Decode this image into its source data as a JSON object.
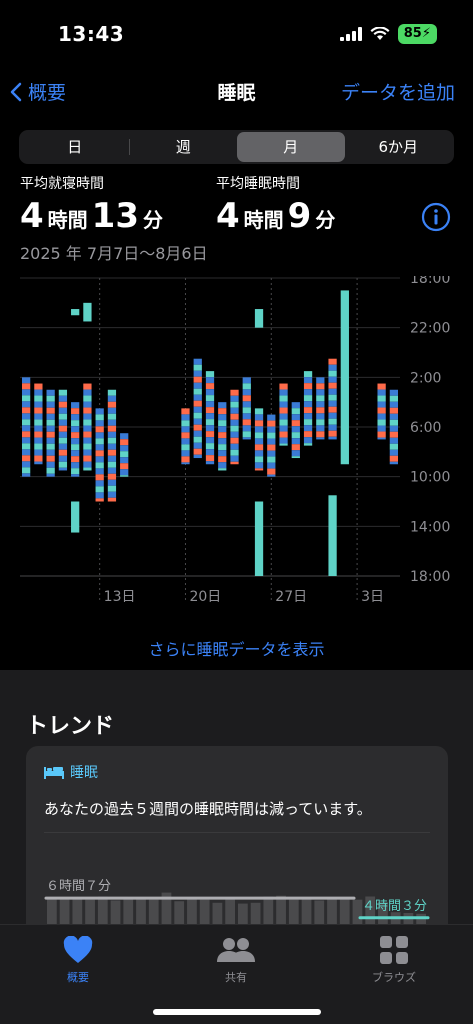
{
  "status": {
    "time": "13:43",
    "battery": "85"
  },
  "nav": {
    "back_label": "概要",
    "title": "睡眠",
    "add_label": "データを追加"
  },
  "segments": [
    "日",
    "週",
    "月",
    "6か月"
  ],
  "active_segment": "月",
  "stats": {
    "bedtime_label": "平均就寝時間",
    "bedtime_hours": "4",
    "bedtime_minutes": "13",
    "sleep_label": "平均睡眠時間",
    "sleep_hours": "4",
    "sleep_minutes": "9",
    "hour_unit": "時間",
    "minute_unit": "分"
  },
  "date_range": "2025 年 7月7日～8月6日",
  "chart_data": {
    "type": "bar",
    "y_tick_labels": [
      "18:00",
      "22:00",
      "2:00",
      "6:00",
      "10:00",
      "14:00",
      "18:00"
    ],
    "x_tick_labels": [
      "13日",
      "20日",
      "27日",
      "3日"
    ],
    "series_colors": {
      "core": "#3a7bd5",
      "deep": "#ff6b4a",
      "rem": "#5fd3c7",
      "awake": "#f06a50"
    },
    "nights": [
      {
        "x": 0,
        "start": 2.0,
        "end": 10.0
      },
      {
        "x": 1,
        "start": 2.5,
        "end": 9.0
      },
      {
        "x": 2,
        "start": 3.0,
        "end": 10.0
      },
      {
        "x": 3,
        "start": 3.0,
        "end": 9.5
      },
      {
        "x": 4,
        "start": 4.0,
        "end": 10.0
      },
      {
        "x": 5,
        "start": 2.5,
        "end": 9.5
      },
      {
        "x": 6,
        "start": 4.5,
        "end": 12.0
      },
      {
        "x": 7,
        "start": 3.0,
        "end": 12.0
      },
      {
        "x": 8,
        "start": 6.5,
        "end": 10.0
      },
      {
        "x": 13,
        "start": 4.5,
        "end": 9.0
      },
      {
        "x": 14,
        "start": 0.5,
        "end": 8.5
      },
      {
        "x": 15,
        "start": 1.5,
        "end": 9.0
      },
      {
        "x": 16,
        "start": 4.0,
        "end": 9.5
      },
      {
        "x": 17,
        "start": 3.0,
        "end": 9.0
      },
      {
        "x": 18,
        "start": 2.0,
        "end": 7.0
      },
      {
        "x": 19,
        "start": 4.5,
        "end": 9.5
      },
      {
        "x": 20,
        "start": 5.0,
        "end": 10.0
      },
      {
        "x": 21,
        "start": 2.5,
        "end": 7.5
      },
      {
        "x": 22,
        "start": 4.0,
        "end": 8.5
      },
      {
        "x": 23,
        "start": 1.5,
        "end": 7.5
      },
      {
        "x": 24,
        "start": 2.0,
        "end": 7.0
      },
      {
        "x": 25,
        "start": 0.5,
        "end": 7.0
      },
      {
        "x": 29,
        "start": 2.5,
        "end": 7.0
      },
      {
        "x": 30,
        "start": 3.0,
        "end": 9.0
      }
    ],
    "naps": [
      {
        "x": 4,
        "start": 12.0,
        "end": 14.5
      },
      {
        "x": 4,
        "start": 20.5,
        "end": 21.0
      },
      {
        "x": 5,
        "start": 20.0,
        "end": 21.5
      },
      {
        "x": 19,
        "start": 12.0,
        "end": 18.0
      },
      {
        "x": 19,
        "start": 20.5,
        "end": 22.0
      },
      {
        "x": 25,
        "start": 11.5,
        "end": 18.0
      },
      {
        "x": 26,
        "start": 19.0,
        "end": 9.0
      }
    ]
  },
  "more_link": "さらに睡眠データを表示",
  "trend": {
    "title": "トレンド",
    "card_title": "睡眠",
    "card_text": "あなたの過去５週間の睡眠時間は減っています。",
    "baseline_label": "６時間７分",
    "current_label": "４時間３分",
    "bars": [
      6.2,
      6.1,
      6.0,
      5.9,
      6.3,
      5.8,
      6.1,
      6.0,
      5.9,
      6.8,
      5.7,
      6.0,
      5.9,
      5.5,
      6.0,
      5.4,
      5.5,
      6.3,
      6.4,
      5.9,
      6.1,
      5.8,
      6.2,
      6.1,
      5.9,
      6.3,
      5.6,
      4.3,
      4.2,
      4.1
    ],
    "colors": {
      "bar": "#4a4a4c",
      "recent_bar": "#48484a",
      "baseline": "#aeaeb2",
      "current": "#5fd3c7"
    }
  },
  "tabs": [
    {
      "label": "概要",
      "icon": "heart-icon",
      "active": true
    },
    {
      "label": "共有",
      "icon": "people-icon",
      "active": false
    },
    {
      "label": "ブラウズ",
      "icon": "grid-icon",
      "active": false
    }
  ]
}
